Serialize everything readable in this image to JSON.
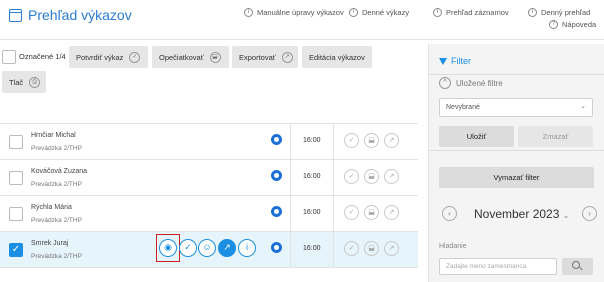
{
  "header": {
    "title": "Prehľad výkazov",
    "links": [
      {
        "label": "Manuálne úpravy výkazov",
        "icon": "info-icon"
      },
      {
        "label": "Denné výkazy",
        "icon": "info-icon"
      },
      {
        "label": "Prehľad záznamov",
        "icon": "info-icon"
      },
      {
        "label": "Denný prehľad",
        "icon": "info-icon"
      },
      {
        "label": "Nápoveda",
        "icon": "help-icon"
      }
    ]
  },
  "toolbar": {
    "marked": "Označené 1/4",
    "confirm": "Potvrdiť výkaz",
    "reprint": "Opečiatkovať",
    "export": "Exportovať",
    "edit": "Editácia výkazov",
    "print": "Tlač"
  },
  "rows": [
    {
      "name": "Hrnčiar Michal",
      "workplace": "Prevádzka 2/THP",
      "time": "16:00",
      "selected": false
    },
    {
      "name": "Kováčová Zuzana",
      "workplace": "Prevádzka 2/THP",
      "time": "16:00",
      "selected": false
    },
    {
      "name": "Rýchla Mária",
      "workplace": "Prevádzka 2/THP",
      "time": "16:00",
      "selected": false
    },
    {
      "name": "Smrek Juraj",
      "workplace": "Prevádzka 2/THP",
      "time": "16:00",
      "selected": true
    }
  ],
  "filter": {
    "title": "Filter",
    "saved_filters": "Uložené filtre",
    "select_value": "Nevybrané",
    "save": "Uložiť",
    "delete": "Zmazať",
    "clear": "Vymazať filter",
    "month": "November 2023",
    "search_label": "Hladanie",
    "search_placeholder": "Zadajte meno zamestnanca"
  },
  "colors": {
    "accent": "#1a8fe3",
    "title": "#2b7cd3",
    "highlight": "#c82020"
  }
}
